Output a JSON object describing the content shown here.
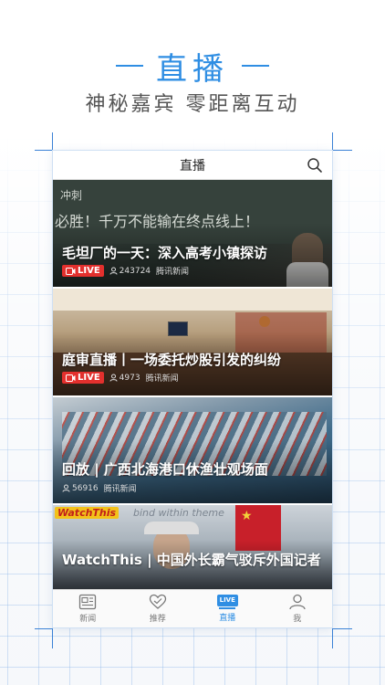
{
  "hero": {
    "title": "直播",
    "subtitle": "神秘嘉宾 零距离互动"
  },
  "nav": {
    "title": "直播"
  },
  "cards": [
    {
      "title": "毛坦厂的一天：深入高考小镇探访",
      "live": true,
      "live_label": "LIVE",
      "views": "243724",
      "source": "腾讯新闻",
      "blackboard_text_1": "冲刺",
      "blackboard_text_2": "必胜！千万不能输在终点线上！"
    },
    {
      "title": "庭审直播丨一场委托炒股引发的纠纷",
      "live": true,
      "live_label": "LIVE",
      "views": "4973",
      "source": "腾讯新闻"
    },
    {
      "title": "回放 | 广西北海港口休渔壮观场面",
      "live": false,
      "views": "56916",
      "source": "腾讯新闻"
    },
    {
      "title": "WatchThis | 中国外长霸气驳斥外国记者",
      "logo_text": "WatchThis",
      "backdrop_text": "bind within theme"
    }
  ],
  "tabbar": {
    "items": [
      {
        "label": "新闻",
        "icon": "news-icon"
      },
      {
        "label": "推荐",
        "icon": "heart-icon"
      },
      {
        "label": "直播",
        "icon": "live-icon",
        "icon_text": "LIVE",
        "active": true
      },
      {
        "label": "我",
        "icon": "person-icon"
      }
    ]
  },
  "colors": {
    "accent": "#2f8ee3",
    "live_red": "#e3302d"
  }
}
